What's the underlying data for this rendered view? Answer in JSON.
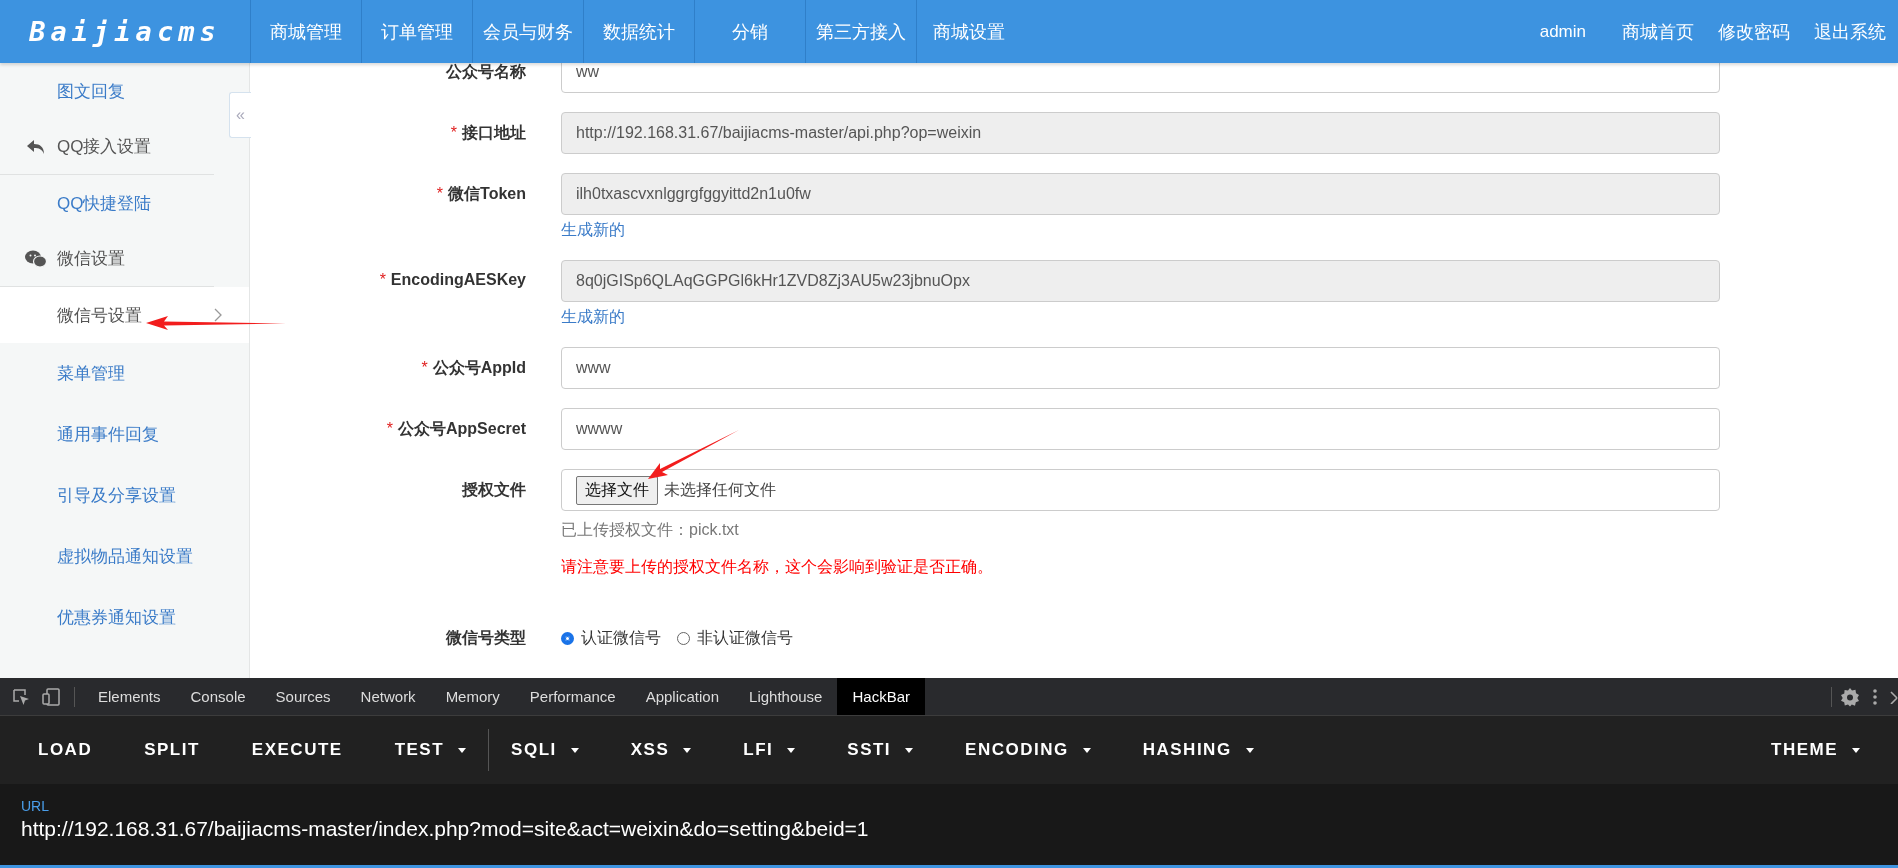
{
  "header": {
    "logo": "Baijiacms",
    "nav": [
      {
        "label": "商城管理",
        "selected": false
      },
      {
        "label": "订单管理",
        "selected": false
      },
      {
        "label": "会员与财务",
        "selected": false
      },
      {
        "label": "数据统计",
        "selected": false
      },
      {
        "label": "分销",
        "selected": false
      },
      {
        "label": "第三方接入",
        "selected": false
      },
      {
        "label": "商城设置",
        "selected": false
      }
    ],
    "user": "admin",
    "links": [
      "商城首页",
      "修改密码",
      "退出系统"
    ]
  },
  "sidebar": {
    "collapse": "«",
    "items": [
      {
        "kind": "link",
        "label": "图文回复",
        "selected": false
      },
      {
        "kind": "group",
        "label": "QQ接入设置"
      },
      {
        "kind": "link",
        "label": "QQ快捷登陆",
        "selected": false
      },
      {
        "kind": "group",
        "label": "微信设置"
      },
      {
        "kind": "link",
        "label": "微信号设置",
        "selected": true
      },
      {
        "kind": "link",
        "label": "菜单管理",
        "selected": false
      },
      {
        "kind": "link",
        "label": "通用事件回复",
        "selected": false
      },
      {
        "kind": "link",
        "label": "引导及分享设置",
        "selected": false
      },
      {
        "kind": "link",
        "label": "虚拟物品通知设置",
        "selected": false
      },
      {
        "kind": "link",
        "label": "优惠券通知设置",
        "selected": false
      }
    ]
  },
  "form": [
    {
      "kind": "text",
      "label": "公众号名称",
      "disabled": false,
      "value": "ww"
    },
    {
      "kind": "text",
      "mark": "*",
      "label": "接口地址",
      "disabled": true,
      "value": "http://192.168.31.67/baijiacms-master/api.php?op=weixin"
    },
    {
      "kind": "text",
      "mark": "*",
      "label": "微信Token",
      "disabled": true,
      "value": "ilh0txascvxnlggrgfggyittd2n1u0fw",
      "action": "生成新的"
    },
    {
      "kind": "text",
      "mark": "*",
      "label": "EncodingAESKey",
      "disabled": true,
      "value": "8q0jGISp6QLAqGGPGl6kHr1ZVD8Zj3AU5w23jbnuOpx",
      "action": "生成新的"
    },
    {
      "kind": "text",
      "mark": "*",
      "label": "公众号AppId",
      "disabled": false,
      "value": "www"
    },
    {
      "kind": "text",
      "mark": "*",
      "label": "公众号AppSecret",
      "disabled": false,
      "value": "wwww"
    },
    {
      "kind": "file",
      "label": "授权文件",
      "button": "选择文件",
      "status": "未选择任何文件",
      "help": "已上传授权文件：pick.txt",
      "warning": "请注意要上传的授权文件名称，这个会影响到验证是否正确。"
    },
    {
      "kind": "radio",
      "label": "微信号类型",
      "options": [
        {
          "label": "认证微信号",
          "selected": true
        },
        {
          "label": "非认证微信号",
          "selected": false
        }
      ]
    }
  ],
  "devtools": {
    "tabs": [
      {
        "label": "Elements",
        "selected": false
      },
      {
        "label": "Console",
        "selected": false
      },
      {
        "label": "Sources",
        "selected": false
      },
      {
        "label": "Network",
        "selected": false
      },
      {
        "label": "Memory",
        "selected": false
      },
      {
        "label": "Performance",
        "selected": false
      },
      {
        "label": "Application",
        "selected": false
      },
      {
        "label": "Lighthouse",
        "selected": false
      },
      {
        "label": "HackBar",
        "selected": true
      }
    ],
    "hackbar": [
      {
        "label": "LOAD",
        "dropdown": false
      },
      {
        "label": "SPLIT",
        "dropdown": false
      },
      {
        "label": "EXECUTE",
        "dropdown": false
      },
      {
        "label": "TEST",
        "dropdown": true
      },
      {
        "label": "SQLI",
        "dropdown": true
      },
      {
        "label": "XSS",
        "dropdown": true
      },
      {
        "label": "LFI",
        "dropdown": true
      },
      {
        "label": "SSTI",
        "dropdown": true
      },
      {
        "label": "ENCODING",
        "dropdown": true
      },
      {
        "label": "HASHING",
        "dropdown": true
      }
    ],
    "theme": {
      "label": "THEME",
      "dropdown": true
    },
    "url_label": "URL",
    "url": "http://192.168.31.67/baijiacms-master/index.php?mod=site&act=weixin&do=setting&beid=1"
  }
}
